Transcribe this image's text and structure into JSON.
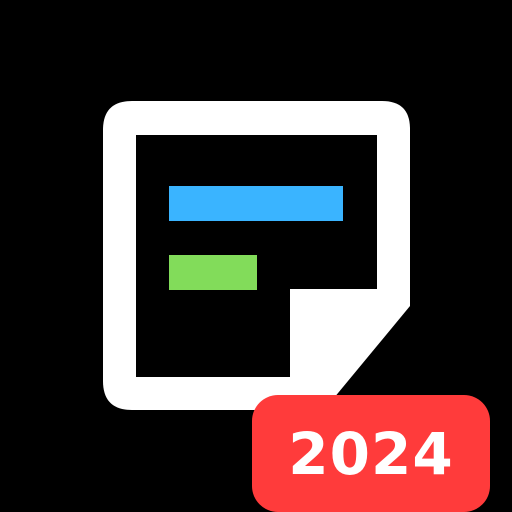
{
  "app_icon": {
    "icon": "sticky-note-icon",
    "background_color": "#000000",
    "note": {
      "outline_color": "#ffffff",
      "fill_color": "#000000",
      "lines": [
        {
          "name": "blue-line",
          "color": "#3ab4ff"
        },
        {
          "name": "green-line",
          "color": "#82dc5a"
        }
      ]
    },
    "badge": {
      "label": "2024",
      "background_color": "#ff3b3b",
      "text_color": "#ffffff"
    }
  }
}
